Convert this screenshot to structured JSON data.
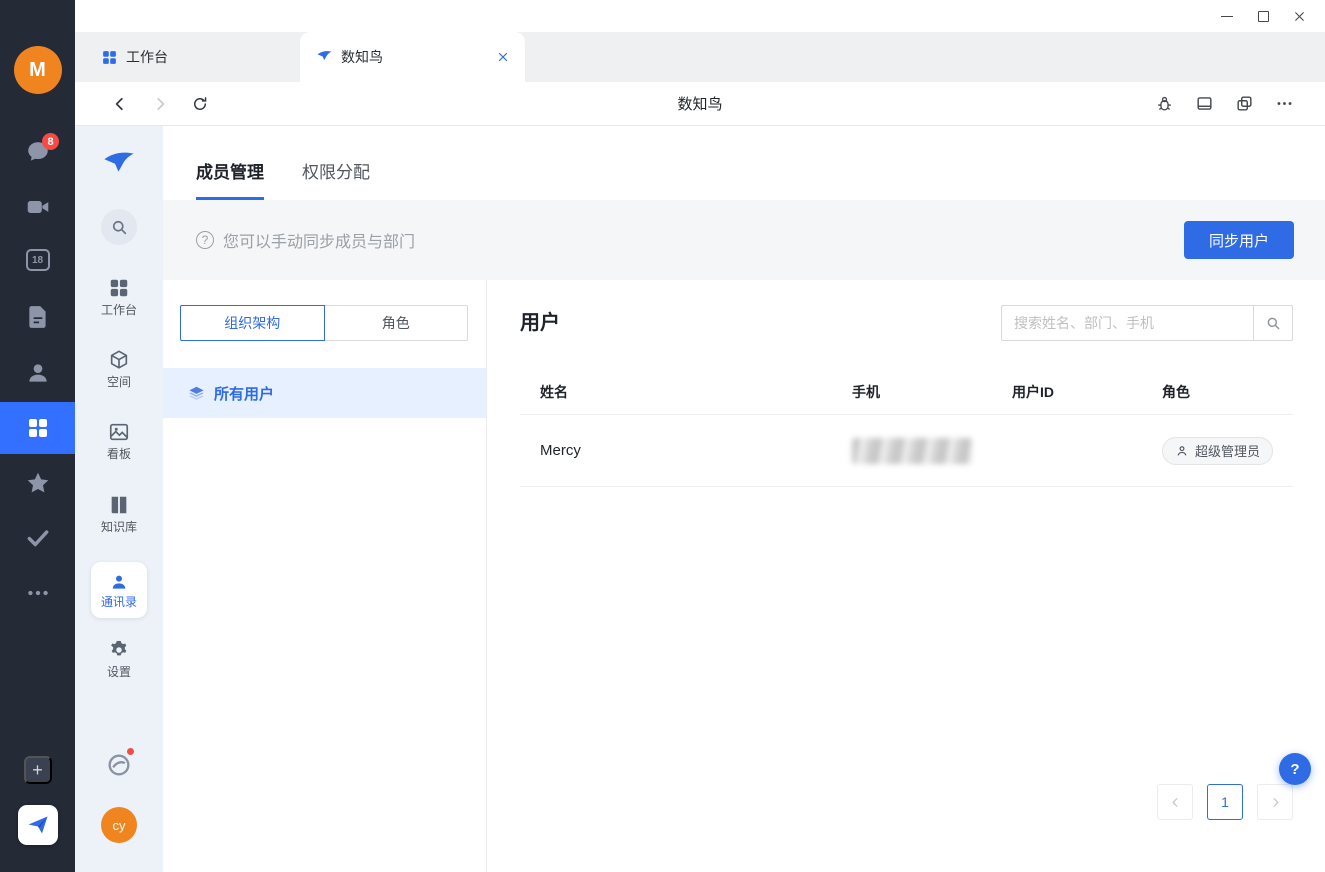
{
  "colors": {
    "accent": "#2E6BE5",
    "rail_bg": "#252A37",
    "rail_selected": "#3370FF",
    "avatar_orange": "#F0841F",
    "badge_red": "#F54A45",
    "sidebar_bg": "#EDF1F8",
    "info_bar_bg": "#F5F6F7",
    "tree_selected_bg": "#E7F0FF"
  },
  "icons": {
    "plus": "+",
    "help": "?",
    "info_help": "?"
  },
  "rail": {
    "avatar_initial": "M",
    "chat_badge": "8",
    "calendar_day": "18"
  },
  "tabbar": {
    "tabs": [
      {
        "label": "工作台"
      },
      {
        "label": "数知鸟"
      }
    ]
  },
  "navbar": {
    "title": "数知鸟"
  },
  "app_sidebar": {
    "items": [
      {
        "label": "工作台"
      },
      {
        "label": "空间"
      },
      {
        "label": "看板"
      },
      {
        "label": "知识库"
      },
      {
        "label": "通讯录"
      },
      {
        "label": "设置"
      }
    ],
    "user_avatar": "cy"
  },
  "content": {
    "tabs": [
      {
        "label": "成员管理"
      },
      {
        "label": "权限分配"
      }
    ],
    "info_bar": {
      "text": "您可以手动同步成员与部门",
      "sync_button": "同步用户"
    },
    "left_panel": {
      "segments": [
        {
          "label": "组织架构"
        },
        {
          "label": "角色"
        }
      ],
      "tree": [
        {
          "label": "所有用户"
        }
      ]
    },
    "users": {
      "title": "用户",
      "search_placeholder": "搜索姓名、部门、手机",
      "columns": [
        "姓名",
        "手机",
        "用户ID",
        "角色"
      ],
      "rows": [
        {
          "name": "Mercy",
          "user_id": "",
          "role": "超级管理员"
        }
      ],
      "pagination": {
        "current_page": "1"
      }
    }
  }
}
